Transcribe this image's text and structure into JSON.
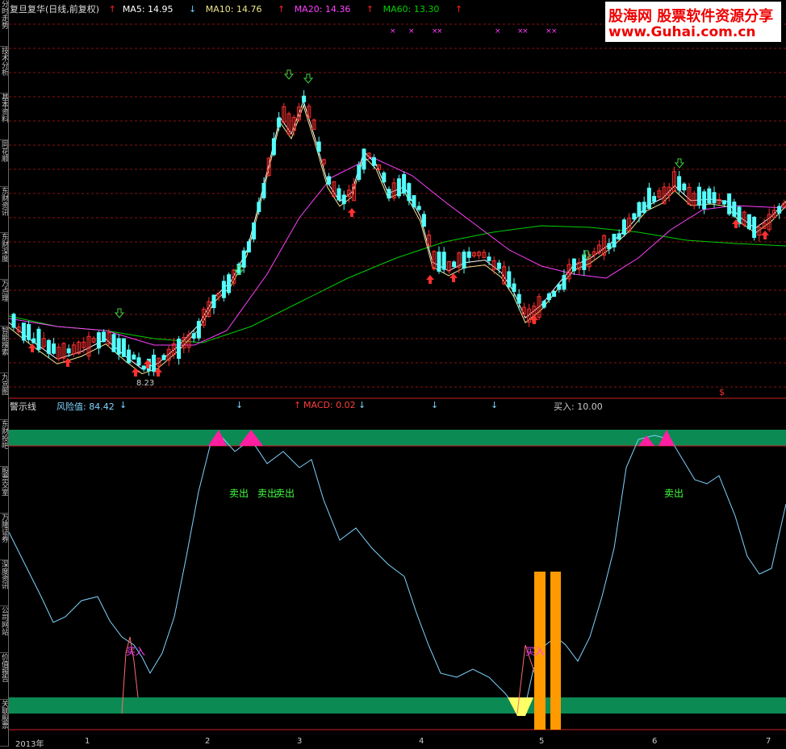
{
  "header": {
    "title": "复旦复华(日线,前复权)",
    "ma5": "MA5: 14.95",
    "ma10": "MA10: 14.76",
    "ma20": "MA20: 14.36",
    "ma60": "MA60: 13.30",
    "ma_colors": {
      "ma5": "#ffffff",
      "ma10": "#f0e68c",
      "ma20": "#ff40ff",
      "ma60": "#00d000"
    }
  },
  "watermark": {
    "cn": "股海网 股票软件资源分享",
    "url": "www.Guhai.com.cn"
  },
  "sidebar": {
    "tabs": [
      "分时走势",
      "技术分析",
      "基本资料",
      "同花顺",
      "东财资讯",
      "东财深度",
      "万点理",
      "智能搜索",
      "九宫图",
      "东财投吧",
      "股票交室",
      "万隆证券",
      "深度资讯",
      "公司网站",
      "价值报告",
      "关联股票"
    ]
  },
  "price_chart": {
    "low_label": "8.23",
    "bottom_marker": "$"
  },
  "indicator": {
    "name": "警示线",
    "risk": "风险值: 84.42",
    "macd": "MACD: 0.02",
    "buy_value": "买入: 10.00",
    "sell_labels": [
      "卖出",
      "卖出",
      "卖出",
      "卖出"
    ],
    "buy_labels": [
      "买入",
      "买入"
    ]
  },
  "xaxis": {
    "labels": [
      "2013年",
      "1",
      "2",
      "3",
      "4",
      "5",
      "6",
      "7"
    ]
  },
  "colors": {
    "up": "#ff3030",
    "down": "#54ffff",
    "band": "#0b8a54",
    "line": "#7fd4ff",
    "orange": "#ff9a00",
    "magenta": "#ff1fa0",
    "yellow": "#ffff66"
  }
}
